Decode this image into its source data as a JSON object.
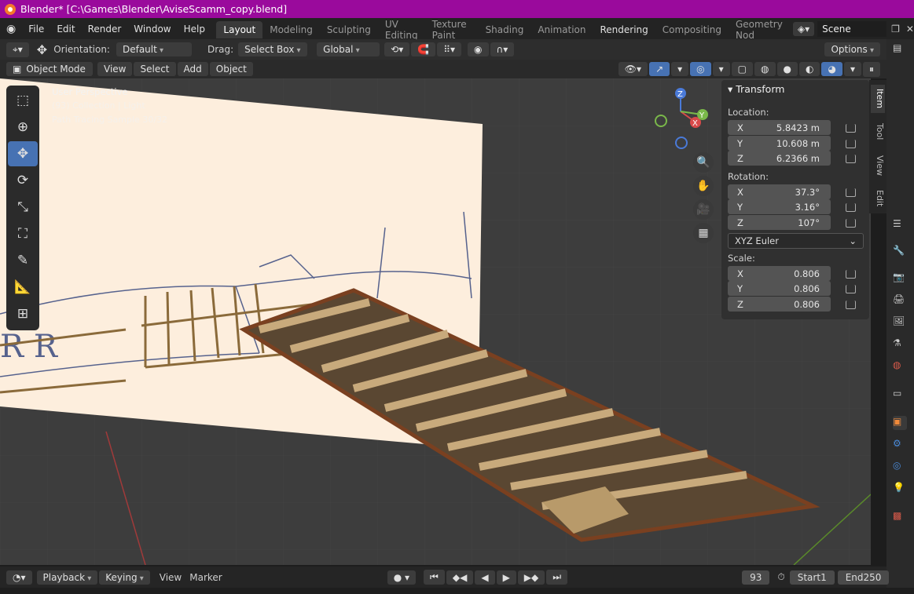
{
  "window": {
    "title": "Blender* [C:\\Games\\Blender\\AviseScamm_copy.blend]"
  },
  "menu": [
    "File",
    "Edit",
    "Render",
    "Window",
    "Help"
  ],
  "workspaces": [
    "Layout",
    "Modeling",
    "Sculpting",
    "UV Editing",
    "Texture Paint",
    "Shading",
    "Animation",
    "Rendering",
    "Compositing",
    "Geometry Nod"
  ],
  "active_workspace": "Layout",
  "scene": {
    "name": "Scene"
  },
  "header": {
    "orientation_label": "Orientation:",
    "orientation_value": "Default",
    "drag_label": "Drag:",
    "drag_value": "Select Box",
    "transform_space": "Global",
    "options": "Options"
  },
  "viewheader": {
    "mode": "Object Mode",
    "menus": [
      "View",
      "Select",
      "Add",
      "Object"
    ]
  },
  "overlay": {
    "perspective": "User Perspective",
    "collection": "(93) Collection | Light",
    "render_status": "Path Tracing Sample 30/32"
  },
  "transform": {
    "title": "Transform",
    "location_label": "Location:",
    "location": [
      {
        "axis": "X",
        "value": "5.8423 m"
      },
      {
        "axis": "Y",
        "value": "10.608 m"
      },
      {
        "axis": "Z",
        "value": "6.2366 m"
      }
    ],
    "rotation_label": "Rotation:",
    "rotation": [
      {
        "axis": "X",
        "value": "37.3°"
      },
      {
        "axis": "Y",
        "value": "3.16°"
      },
      {
        "axis": "Z",
        "value": "107°"
      }
    ],
    "rotation_mode": "XYZ Euler",
    "scale_label": "Scale:",
    "scale": [
      {
        "axis": "X",
        "value": "0.806"
      },
      {
        "axis": "Y",
        "value": "0.806"
      },
      {
        "axis": "Z",
        "value": "0.806"
      }
    ]
  },
  "sidetabs": [
    "Item",
    "Tool",
    "View",
    "Edit"
  ],
  "timeline": {
    "menus": [
      "Playback",
      "Keying",
      "View",
      "Marker"
    ],
    "current_frame": "93",
    "start_label": "Start",
    "start": "1",
    "end_label": "End",
    "end": "250"
  },
  "colors": {
    "title_bar": "#9a0a9c",
    "accent": "#4772b3",
    "viewport": "#3d3d3d",
    "plane": "#fdeedd",
    "wood": "#c8aa7c"
  }
}
